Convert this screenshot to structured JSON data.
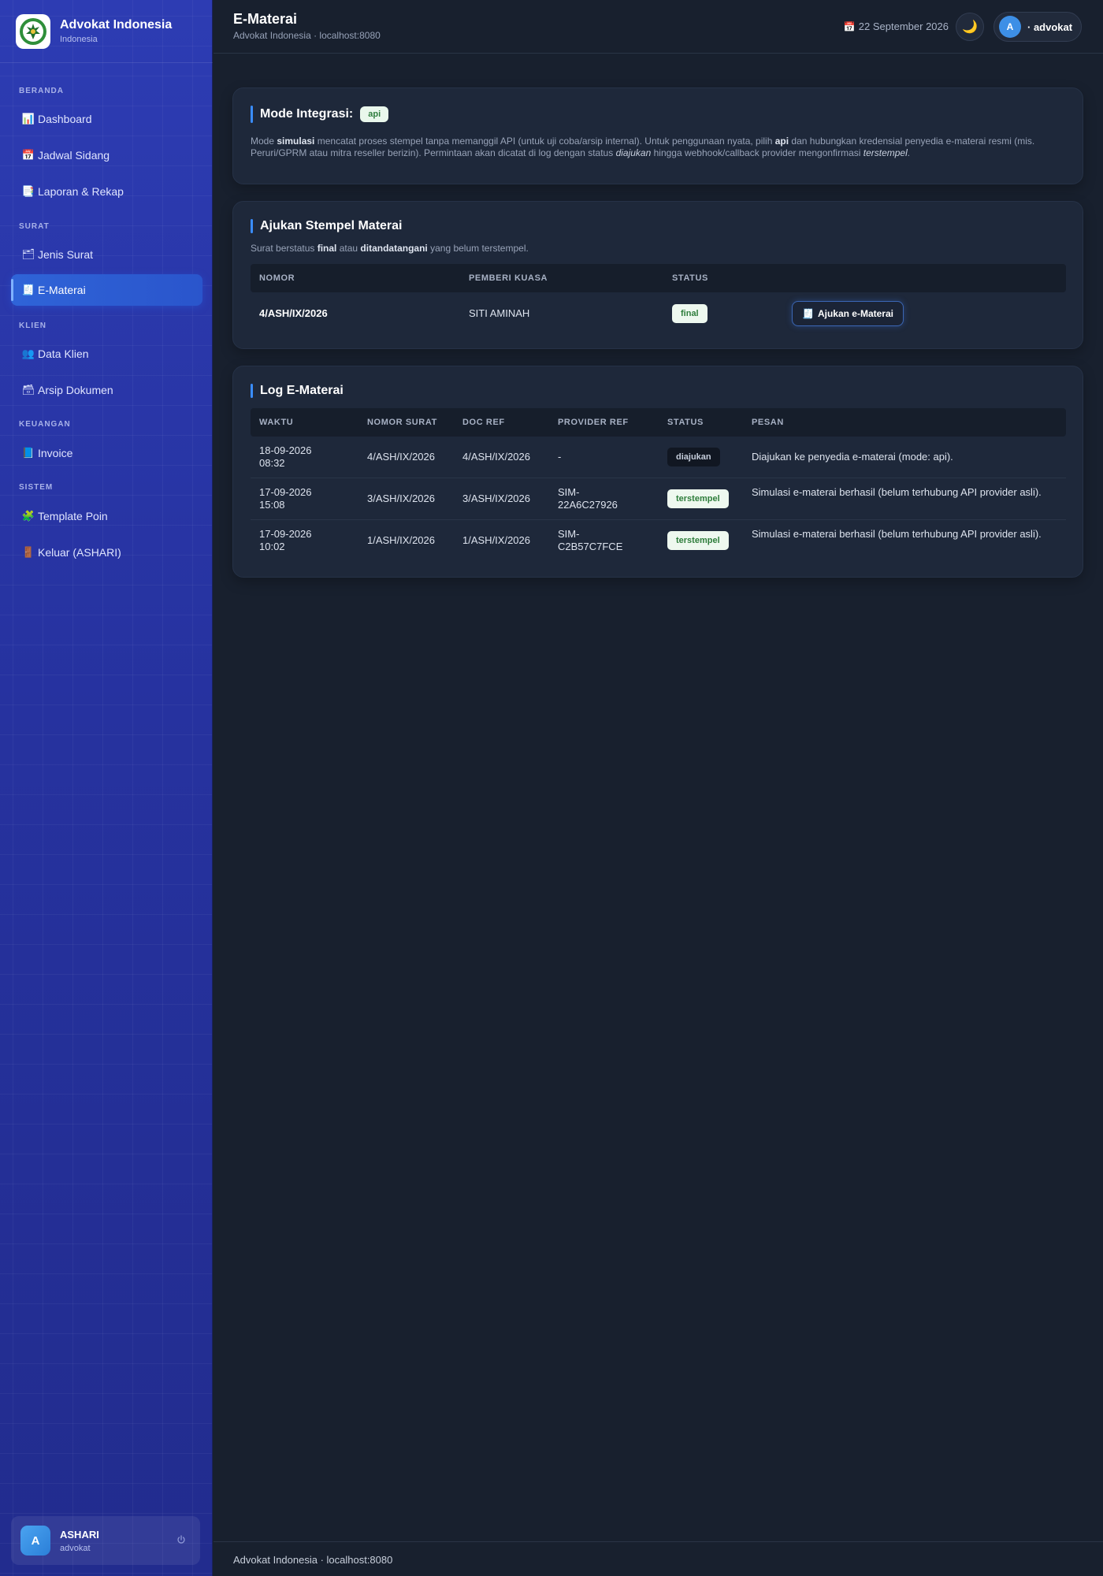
{
  "app": {
    "name": "Advokat Indonesia",
    "subtitle": "Indonesia"
  },
  "sidebar": {
    "sections": [
      {
        "label": "BERANDA"
      },
      {
        "label": "SURAT"
      },
      {
        "label": "KLIEN"
      },
      {
        "label": "KEUANGAN"
      },
      {
        "label": "SISTEM"
      }
    ],
    "items": [
      {
        "label": "Dashboard",
        "icon": "bar-chart-icon",
        "glyph": "📊"
      },
      {
        "label": "Jadwal Sidang",
        "icon": "calendar-icon",
        "glyph": "📅"
      },
      {
        "label": "Laporan & Rekap",
        "icon": "report-icon",
        "glyph": "📑"
      },
      {
        "label": "Jenis Surat",
        "icon": "folder-icon",
        "glyph": "🗂"
      },
      {
        "label": "E-Materai",
        "icon": "receipt-icon",
        "glyph": "🧾",
        "active": true
      },
      {
        "label": "Data Klien",
        "icon": "users-icon",
        "glyph": "👥"
      },
      {
        "label": "Arsip Dokumen",
        "icon": "archive-icon",
        "glyph": "🗃"
      },
      {
        "label": "Invoice",
        "icon": "invoice-icon",
        "glyph": "📘"
      },
      {
        "label": "Template Poin",
        "icon": "puzzle-icon",
        "glyph": "🧩"
      },
      {
        "label": "Keluar (ASHARI)",
        "icon": "door-icon",
        "glyph": "🚪"
      }
    ],
    "user": {
      "initial": "A",
      "name": "ASHARI",
      "role": "advokat"
    }
  },
  "header": {
    "title": "E-Materai",
    "subtitle": "Advokat Indonesia · localhost:8080",
    "date": "22 September 2026",
    "date_icon": "📅",
    "theme_icon": "🌙",
    "account_initial": "A",
    "account_label": "· advokat"
  },
  "mode_card": {
    "title": "Mode Integrasi:",
    "mode": "api",
    "desc": {
      "p1": "Mode ",
      "b1": "simulasi",
      "p2": " mencatat proses stempel tanpa memanggil API (untuk uji coba/arsip internal). Untuk penggunaan nyata, pilih ",
      "b2": "api",
      "p3": " dan hubungkan kredensial penyedia e-materai resmi (mis. Peruri/GPRM atau mitra reseller berizin). Permintaan akan dicatat di log dengan status ",
      "i1": "diajukan",
      "p4": " hingga webhook/callback provider mengonfirmasi ",
      "i2": "terstempel",
      "p5": "."
    }
  },
  "submit_card": {
    "title": "Ajukan Stempel Materai",
    "desc": {
      "p1": "Surat berstatus ",
      "b1": "final",
      "p2": " atau ",
      "b2": "ditandatangani",
      "p3": " yang belum terstempel."
    },
    "columns": [
      "NOMOR",
      "PEMBERI KUASA",
      "STATUS"
    ],
    "rows": [
      {
        "nomor": "4/ASH/IX/2026",
        "pemberi_kuasa": "SITI AMINAH",
        "status": "final",
        "action": "Ajukan e-Materai",
        "action_icon": "🧾"
      }
    ]
  },
  "log_card": {
    "title": "Log E-Materai",
    "columns": [
      "WAKTU",
      "NOMOR SURAT",
      "DOC REF",
      "PROVIDER REF",
      "STATUS",
      "PESAN"
    ],
    "rows": [
      {
        "waktu_date": "18-09-2026",
        "waktu_time": "08:32",
        "nomor": "4/ASH/IX/2026",
        "doc_ref": "4/ASH/IX/2026",
        "provider_ref_1": "-",
        "provider_ref_2": "",
        "status": "diajukan",
        "status_color": "dark",
        "pesan": "Diajukan ke penyedia e-materai (mode: api)."
      },
      {
        "waktu_date": "17-09-2026",
        "waktu_time": "15:08",
        "nomor": "3/ASH/IX/2026",
        "doc_ref": "3/ASH/IX/2026",
        "provider_ref_1": "SIM-",
        "provider_ref_2": "22A6C27926",
        "status": "terstempel",
        "status_color": "green",
        "pesan": "Simulasi e-materai berhasil (belum terhubung API provider asli)."
      },
      {
        "waktu_date": "17-09-2026",
        "waktu_time": "10:02",
        "nomor": "1/ASH/IX/2026",
        "doc_ref": "1/ASH/IX/2026",
        "provider_ref_1": "SIM-",
        "provider_ref_2": "C2B57C7FCE",
        "status": "terstempel",
        "status_color": "green",
        "pesan": "Simulasi e-materai berhasil (belum terhubung API provider asli)."
      }
    ]
  },
  "footer": {
    "text": "Advokat Indonesia · localhost:8080"
  }
}
